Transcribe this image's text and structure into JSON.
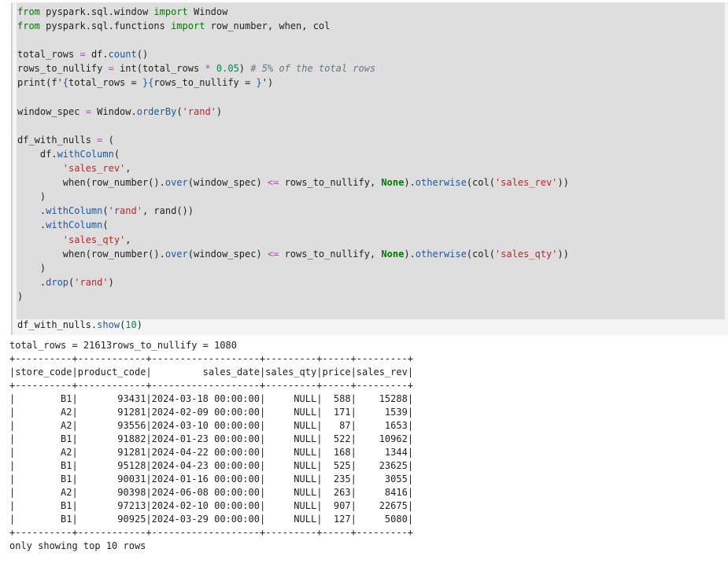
{
  "code_cell": {
    "lines": [
      {
        "segments": [
          {
            "t": "kw",
            "v": "from"
          },
          {
            "t": "",
            "v": " pyspark.sql.window "
          },
          {
            "t": "kw",
            "v": "import"
          },
          {
            "t": "",
            "v": " Window"
          }
        ]
      },
      {
        "segments": [
          {
            "t": "kw",
            "v": "from"
          },
          {
            "t": "",
            "v": " pyspark.sql.functions "
          },
          {
            "t": "kw",
            "v": "import"
          },
          {
            "t": "",
            "v": " row_number, when, col"
          }
        ]
      },
      {
        "segments": []
      },
      {
        "segments": [
          {
            "t": "",
            "v": "total_rows "
          },
          {
            "t": "op",
            "v": "="
          },
          {
            "t": "",
            "v": " df."
          },
          {
            "t": "fn",
            "v": "count"
          },
          {
            "t": "",
            "v": "()"
          }
        ]
      },
      {
        "segments": [
          {
            "t": "",
            "v": "rows_to_nullify "
          },
          {
            "t": "op",
            "v": "="
          },
          {
            "t": "",
            "v": " int(total_rows "
          },
          {
            "t": "op",
            "v": "*"
          },
          {
            "t": "",
            "v": " "
          },
          {
            "t": "num",
            "v": "0.05"
          },
          {
            "t": "",
            "v": ") "
          },
          {
            "t": "cmt",
            "v": "# 5% of the total rows"
          }
        ]
      },
      {
        "segments": [
          {
            "t": "",
            "v": "print(f'"
          },
          {
            "t": "fn",
            "v": "{"
          },
          {
            "t": "",
            "v": "total_rows = "
          },
          {
            "t": "fn",
            "v": "}{"
          },
          {
            "t": "",
            "v": "rows_to_nullify = "
          },
          {
            "t": "fn",
            "v": "}"
          },
          {
            "t": "",
            "v": "')"
          }
        ]
      },
      {
        "segments": []
      },
      {
        "segments": [
          {
            "t": "",
            "v": "window_spec "
          },
          {
            "t": "op",
            "v": "="
          },
          {
            "t": "",
            "v": " Window."
          },
          {
            "t": "fn",
            "v": "orderBy"
          },
          {
            "t": "",
            "v": "("
          },
          {
            "t": "str",
            "v": "'rand'"
          },
          {
            "t": "",
            "v": ")"
          }
        ]
      },
      {
        "segments": []
      },
      {
        "segments": [
          {
            "t": "",
            "v": "df_with_nulls "
          },
          {
            "t": "op",
            "v": "="
          },
          {
            "t": "",
            "v": " ("
          }
        ]
      },
      {
        "segments": [
          {
            "t": "",
            "v": "    df."
          },
          {
            "t": "fn",
            "v": "withColumn"
          },
          {
            "t": "",
            "v": "("
          }
        ]
      },
      {
        "segments": [
          {
            "t": "",
            "v": "        "
          },
          {
            "t": "str",
            "v": "'sales_rev'"
          },
          {
            "t": "",
            "v": ","
          }
        ]
      },
      {
        "segments": [
          {
            "t": "",
            "v": "        when(row_number()."
          },
          {
            "t": "fn",
            "v": "over"
          },
          {
            "t": "",
            "v": "(window_spec) "
          },
          {
            "t": "op",
            "v": "<="
          },
          {
            "t": "",
            "v": " rows_to_nullify, "
          },
          {
            "t": "kwb",
            "v": "None"
          },
          {
            "t": "",
            "v": ")."
          },
          {
            "t": "fn",
            "v": "otherwise"
          },
          {
            "t": "",
            "v": "(col("
          },
          {
            "t": "str",
            "v": "'sales_rev'"
          },
          {
            "t": "",
            "v": "))"
          }
        ]
      },
      {
        "segments": [
          {
            "t": "",
            "v": "    )"
          }
        ]
      },
      {
        "segments": [
          {
            "t": "",
            "v": "    ."
          },
          {
            "t": "fn",
            "v": "withColumn"
          },
          {
            "t": "",
            "v": "("
          },
          {
            "t": "str",
            "v": "'rand'"
          },
          {
            "t": "",
            "v": ", rand())"
          }
        ]
      },
      {
        "segments": [
          {
            "t": "",
            "v": "    ."
          },
          {
            "t": "fn",
            "v": "withColumn"
          },
          {
            "t": "",
            "v": "("
          }
        ]
      },
      {
        "segments": [
          {
            "t": "",
            "v": "        "
          },
          {
            "t": "str",
            "v": "'sales_qty'"
          },
          {
            "t": "",
            "v": ","
          }
        ]
      },
      {
        "segments": [
          {
            "t": "",
            "v": "        when(row_number()."
          },
          {
            "t": "fn",
            "v": "over"
          },
          {
            "t": "",
            "v": "(window_spec) "
          },
          {
            "t": "op",
            "v": "<="
          },
          {
            "t": "",
            "v": " rows_to_nullify, "
          },
          {
            "t": "kwb",
            "v": "None"
          },
          {
            "t": "",
            "v": ")."
          },
          {
            "t": "fn",
            "v": "otherwise"
          },
          {
            "t": "",
            "v": "(col("
          },
          {
            "t": "str",
            "v": "'sales_qty'"
          },
          {
            "t": "",
            "v": "))"
          }
        ]
      },
      {
        "segments": [
          {
            "t": "",
            "v": "    )"
          }
        ]
      },
      {
        "segments": [
          {
            "t": "",
            "v": "    ."
          },
          {
            "t": "fn",
            "v": "drop"
          },
          {
            "t": "",
            "v": "("
          },
          {
            "t": "str",
            "v": "'rand'"
          },
          {
            "t": "",
            "v": ")"
          }
        ]
      },
      {
        "segments": [
          {
            "t": "",
            "v": ")"
          }
        ]
      },
      {
        "segments": []
      },
      {
        "segments": [
          {
            "t": "",
            "v": "df_with_nulls."
          },
          {
            "t": "fn",
            "v": "show"
          },
          {
            "t": "",
            "v": "("
          },
          {
            "t": "num",
            "v": "10"
          },
          {
            "t": "",
            "v": ")"
          }
        ]
      }
    ]
  },
  "output": {
    "print_line": "total_rows = 21613rows_to_nullify = 1080",
    "table": {
      "columns": [
        "store_code",
        "product_code",
        "sales_date",
        "sales_qty",
        "price",
        "sales_rev"
      ],
      "rows": [
        [
          "B1",
          "93431",
          "2024-03-18 00:00:00",
          "NULL",
          "588",
          "15288"
        ],
        [
          "A2",
          "91281",
          "2024-02-09 00:00:00",
          "NULL",
          "171",
          "1539"
        ],
        [
          "A2",
          "93556",
          "2024-03-10 00:00:00",
          "NULL",
          "87",
          "1653"
        ],
        [
          "B1",
          "91882",
          "2024-01-23 00:00:00",
          "NULL",
          "522",
          "10962"
        ],
        [
          "A2",
          "91281",
          "2024-04-22 00:00:00",
          "NULL",
          "168",
          "1344"
        ],
        [
          "B1",
          "95128",
          "2024-04-23 00:00:00",
          "NULL",
          "525",
          "23625"
        ],
        [
          "B1",
          "90031",
          "2024-01-16 00:00:00",
          "NULL",
          "235",
          "3055"
        ],
        [
          "A2",
          "90398",
          "2024-06-08 00:00:00",
          "NULL",
          "263",
          "8416"
        ],
        [
          "B1",
          "97213",
          "2024-02-10 00:00:00",
          "NULL",
          "907",
          "22675"
        ],
        [
          "B1",
          "90925",
          "2024-03-29 00:00:00",
          "NULL",
          "127",
          "5080"
        ]
      ]
    },
    "footer_line": "only showing top 10 rows"
  }
}
